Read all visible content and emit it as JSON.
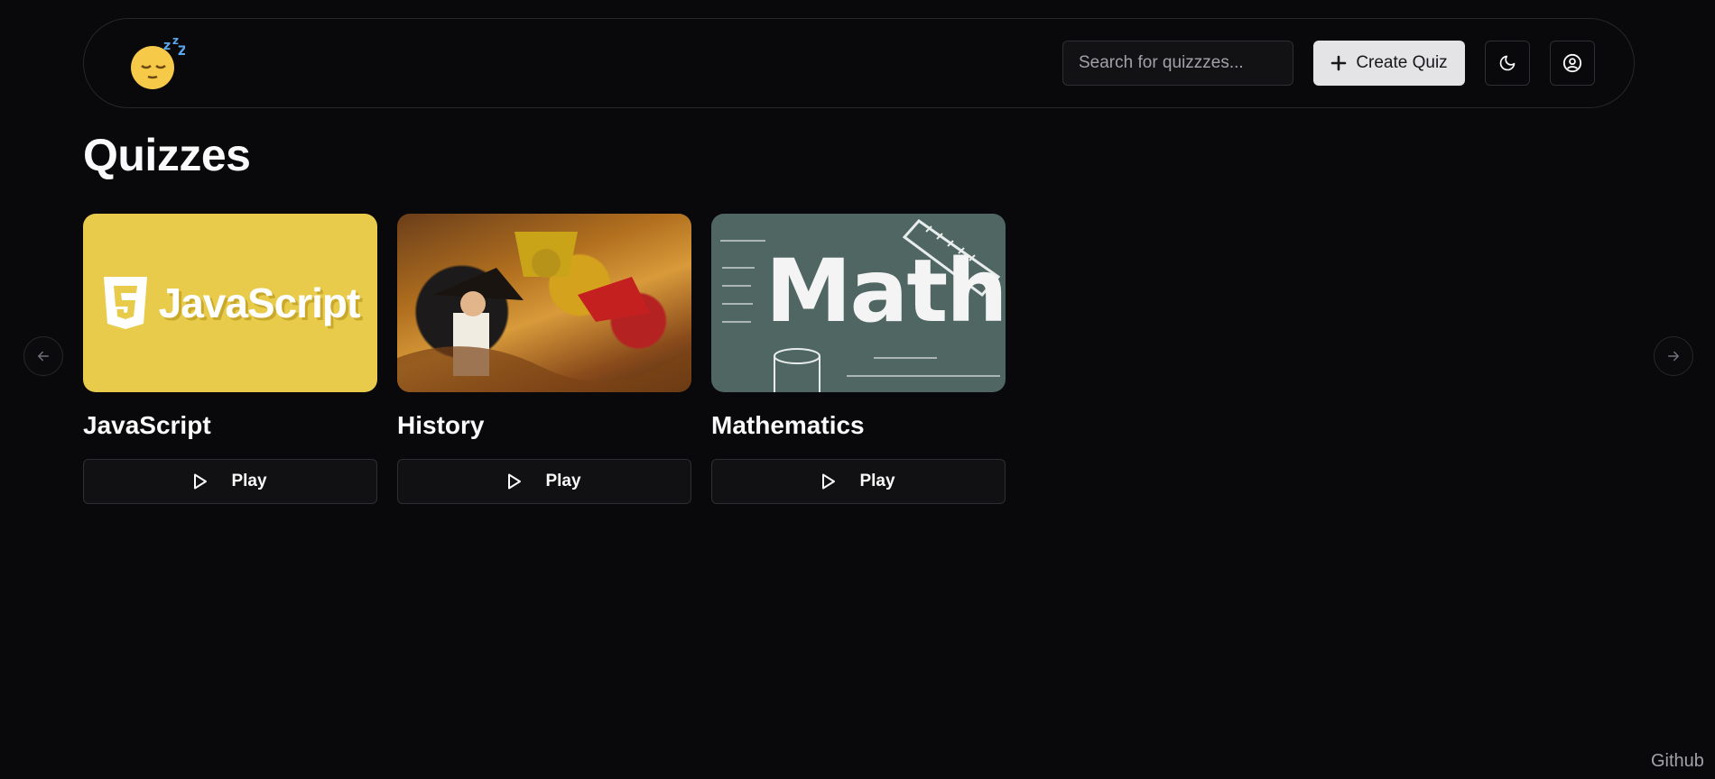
{
  "app": {
    "logo_emoji": "😴"
  },
  "header": {
    "search_placeholder": "Search for quizzzes...",
    "create_label": "Create Quiz"
  },
  "page": {
    "title": "Quizzes"
  },
  "cards": [
    {
      "title": "JavaScript",
      "play_label": "Play",
      "art_text": "JavaScript"
    },
    {
      "title": "History",
      "play_label": "Play"
    },
    {
      "title": "Mathematics",
      "play_label": "Play",
      "art_text": "Math"
    }
  ],
  "footer": {
    "github_label": "Github"
  },
  "colors": {
    "background": "#09090b",
    "js_yellow": "#e8cb4b",
    "chalkboard": "#4f6663"
  },
  "icons": [
    "plus-icon",
    "moon-icon",
    "user-circle-icon",
    "play-icon",
    "arrow-left-icon",
    "arrow-right-icon"
  ]
}
